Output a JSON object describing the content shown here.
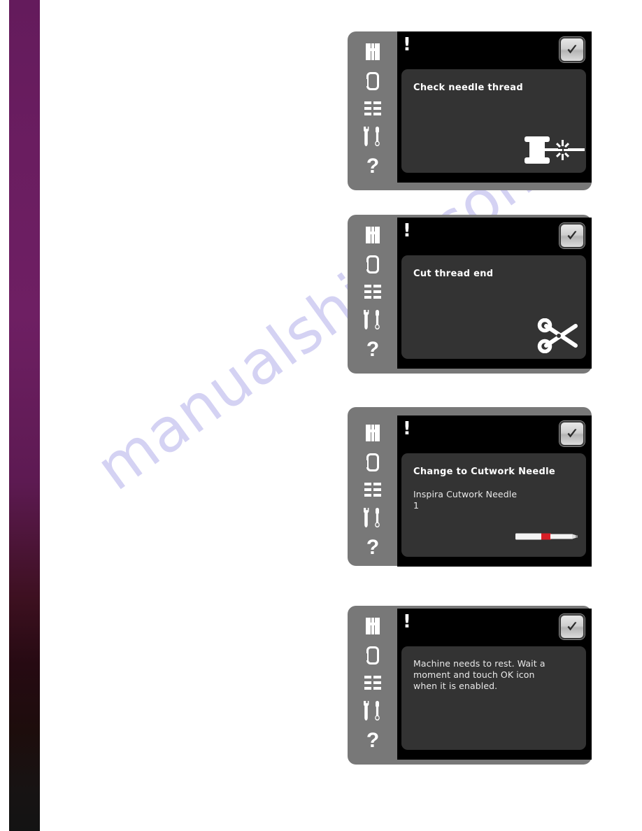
{
  "page": {
    "watermark": "manualshive.com",
    "background_color": "#ffffff",
    "left_band_top_color": "#6a1d60",
    "left_band_bottom_color": "#131313"
  },
  "panels": [
    {
      "id": "panel-check-needle-thread",
      "alert_marker": "!",
      "ok_label": "OK",
      "title": "Check needle thread",
      "body": "",
      "illustration": "thread-spool-icon",
      "sidebar": [
        {
          "name": "sidebar-item-sewing-mode",
          "icon": "sewing-machine-icon"
        },
        {
          "name": "sidebar-item-embroidery-mode",
          "icon": "embroidery-hoop-icon"
        },
        {
          "name": "sidebar-item-menu",
          "icon": "menu-list-icon"
        },
        {
          "name": "sidebar-item-settings",
          "icon": "tools-wrench-screwdriver-icon"
        },
        {
          "name": "sidebar-item-help",
          "icon": "question-mark-icon"
        }
      ]
    },
    {
      "id": "panel-cut-thread-end",
      "alert_marker": "!",
      "ok_label": "OK",
      "title": "Cut thread end",
      "body": "",
      "illustration": "scissors-icon",
      "sidebar": [
        {
          "name": "sidebar-item-sewing-mode",
          "icon": "sewing-machine-icon"
        },
        {
          "name": "sidebar-item-embroidery-mode",
          "icon": "embroidery-hoop-icon"
        },
        {
          "name": "sidebar-item-menu",
          "icon": "menu-list-icon"
        },
        {
          "name": "sidebar-item-settings",
          "icon": "tools-wrench-screwdriver-icon"
        },
        {
          "name": "sidebar-item-help",
          "icon": "question-mark-icon"
        }
      ]
    },
    {
      "id": "panel-change-cutwork-needle",
      "alert_marker": "!",
      "ok_label": "OK",
      "title": "Change to Cutwork Needle",
      "body": "Inspira Cutwork Needle\n1",
      "illustration": "cutwork-needle-icon",
      "needle_band_color": "#d81f26",
      "sidebar": [
        {
          "name": "sidebar-item-sewing-mode",
          "icon": "sewing-machine-icon"
        },
        {
          "name": "sidebar-item-embroidery-mode",
          "icon": "embroidery-hoop-icon"
        },
        {
          "name": "sidebar-item-menu",
          "icon": "menu-list-icon"
        },
        {
          "name": "sidebar-item-settings",
          "icon": "tools-wrench-screwdriver-icon"
        },
        {
          "name": "sidebar-item-help",
          "icon": "question-mark-icon"
        }
      ]
    },
    {
      "id": "panel-machine-needs-rest",
      "alert_marker": "!",
      "ok_label": "OK",
      "title": "",
      "body": "Machine needs to rest. Wait a\nmoment and touch OK icon\nwhen it is enabled.",
      "illustration": "none",
      "sidebar": [
        {
          "name": "sidebar-item-sewing-mode",
          "icon": "sewing-machine-icon"
        },
        {
          "name": "sidebar-item-embroidery-mode",
          "icon": "embroidery-hoop-icon"
        },
        {
          "name": "sidebar-item-menu",
          "icon": "menu-list-icon"
        },
        {
          "name": "sidebar-item-settings",
          "icon": "tools-wrench-screwdriver-icon"
        },
        {
          "name": "sidebar-item-help",
          "icon": "question-mark-icon"
        }
      ]
    }
  ]
}
